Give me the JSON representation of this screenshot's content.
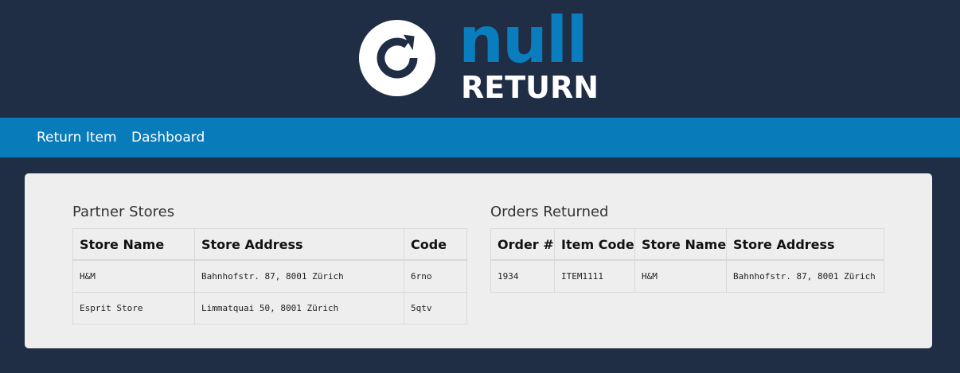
{
  "brand": {
    "logo_icon": "refresh-arrow-icon",
    "name_top": "null",
    "name_bottom": "RETURN",
    "colors": {
      "background": "#1f2d45",
      "accent": "#0a7dbf",
      "nav": "#087bbb",
      "panel": "#eeeeee"
    }
  },
  "nav": {
    "items": [
      {
        "label": "Return Item"
      },
      {
        "label": "Dashboard"
      }
    ]
  },
  "partner_stores": {
    "title": "Partner Stores",
    "columns": [
      "Store Name",
      "Store Address",
      "Code"
    ],
    "rows": [
      {
        "store_name": "H&M",
        "store_address": "Bahnhofstr. 87, 8001 Zürich",
        "code": "6rno"
      },
      {
        "store_name": "Esprit Store",
        "store_address": "Limmatquai 50, 8001 Zürich",
        "code": "5qtv"
      }
    ]
  },
  "orders_returned": {
    "title": "Orders Returned",
    "columns": [
      "Order #",
      "Item Code",
      "Store Name",
      "Store Address"
    ],
    "rows": [
      {
        "order_no": "1934",
        "item_code": "ITEM1111",
        "store_name": "H&M",
        "store_address": "Bahnhofstr. 87, 8001 Zürich"
      }
    ]
  }
}
